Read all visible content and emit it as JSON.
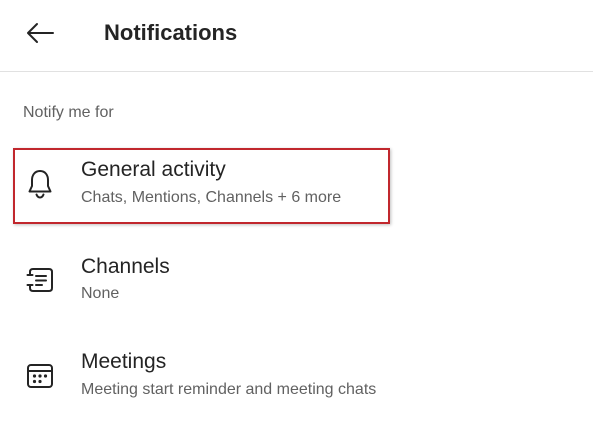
{
  "header": {
    "back_icon": "arrow-left-icon",
    "title": "Notifications"
  },
  "section": {
    "label": "Notify me for"
  },
  "items": [
    {
      "icon": "bell-icon",
      "title": "General activity",
      "subtitle": "Chats, Mentions, Channels +  6 more",
      "highlighted": true
    },
    {
      "icon": "channels-icon",
      "title": "Channels",
      "subtitle": "None"
    },
    {
      "icon": "calendar-icon",
      "title": "Meetings",
      "subtitle": "Meeting start reminder and meeting chats"
    }
  ],
  "colors": {
    "highlight_border": "#c1272d",
    "title_text": "#242424",
    "secondary_text": "#616161",
    "divider": "#e1e1e1"
  }
}
